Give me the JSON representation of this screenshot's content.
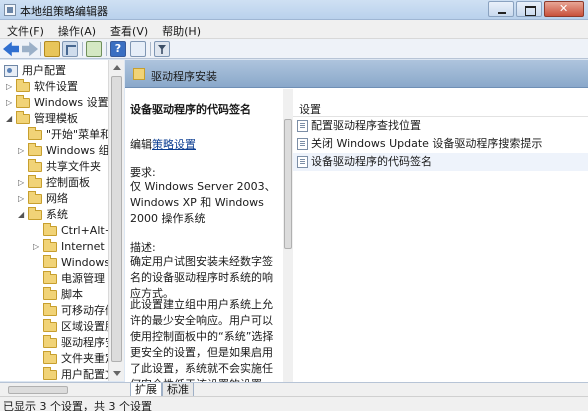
{
  "window": {
    "title": "本地组策略编辑器"
  },
  "menu": [
    "文件(F)",
    "操作(A)",
    "查看(V)",
    "帮助(H)"
  ],
  "toolbar": {
    "icons": [
      "back-arrow-icon",
      "forward-arrow-icon",
      "up-folder-icon",
      "show-tree-icon",
      "export-list-icon",
      "help-icon",
      "view-icon",
      "filter-icon"
    ]
  },
  "tree": {
    "items": [
      {
        "label": "用户配置",
        "kind": "root"
      },
      {
        "label": "软件设置",
        "kind": "folder"
      },
      {
        "label": "Windows 设置",
        "kind": "folder"
      },
      {
        "label": "管理模板",
        "kind": "folder"
      },
      {
        "label": "\"开始\"菜单和",
        "kind": "folder"
      },
      {
        "label": "Windows 组件",
        "kind": "folder"
      },
      {
        "label": "共享文件夹",
        "kind": "folder"
      },
      {
        "label": "控制面板",
        "kind": "folder"
      },
      {
        "label": "网络",
        "kind": "folder"
      },
      {
        "label": "系统",
        "kind": "folder"
      },
      {
        "label": "Ctrl+Alt+D",
        "kind": "folder"
      },
      {
        "label": "Internet 通",
        "kind": "folder"
      },
      {
        "label": "Windows",
        "kind": "folder"
      },
      {
        "label": "电源管理",
        "kind": "folder"
      },
      {
        "label": "脚本",
        "kind": "folder"
      },
      {
        "label": "可移动存储",
        "kind": "folder"
      },
      {
        "label": "区域设置服",
        "kind": "folder"
      },
      {
        "label": "驱动程序安",
        "kind": "folder"
      },
      {
        "label": "文件夹重定",
        "kind": "folder"
      },
      {
        "label": "用户配置文",
        "kind": "folder"
      }
    ]
  },
  "pane": {
    "header": "驱动程序安装",
    "policy_title": "设备驱动程序的代码签名",
    "edit_prefix": "编辑",
    "edit_link": "策略设置",
    "requirements_label": "要求:",
    "requirements_text": "仅 Windows Server 2003、Windows XP 和 Windows 2000 操作系统",
    "description_label": "描述:",
    "description_text": "确定用户试图安装未经数字签名的设备驱动程序时系统的响应方式。",
    "description_text2": "此设置建立组中用户系统上允许的最少安全响应。用户可以使用控制面板中的“系统”选择更安全的设置，但是如果启用了此设置，系统就不会实施任何安全性低于该设置的设置。"
  },
  "settings": {
    "header": "设置",
    "rows": [
      "配置驱动程序查找位置",
      "关闭 Windows Update 设备驱动程序搜索提示",
      "设备驱动程序的代码签名"
    ]
  },
  "tabs": [
    "扩展",
    "标准"
  ],
  "status": "已显示 3 个设置，共 3 个设置"
}
